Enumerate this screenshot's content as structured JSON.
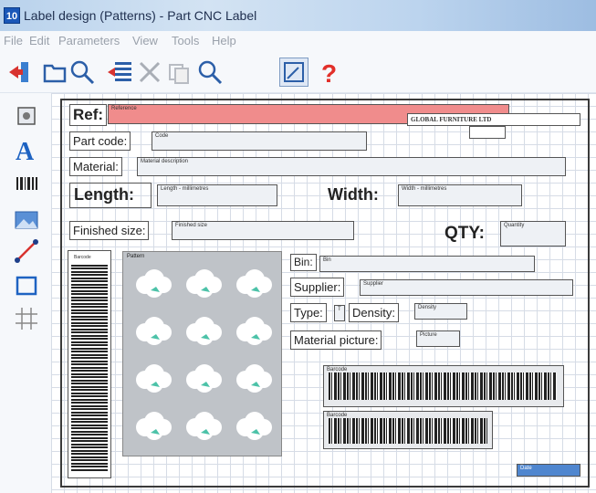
{
  "window": {
    "app_icon": "10",
    "title": "Label design (Patterns) - Part CNC Label"
  },
  "menu": [
    "File",
    "Edit",
    "Parameters",
    "View",
    "Tools",
    "Help"
  ],
  "toolbar_icons": [
    "exit-icon",
    "open-icon",
    "print-preview-icon",
    "import-icon",
    "cut-icon",
    "copy-icon",
    "zoom-icon",
    "select-icon",
    "help-icon"
  ],
  "left_tools": [
    "image-tool-icon",
    "text-tool-icon",
    "barcode-tool-icon",
    "picture-tool-icon",
    "line-tool-icon",
    "rectangle-tool-icon",
    "grid-tool-icon"
  ],
  "label": {
    "ref_label": "Ref:",
    "ref_value": "Reference",
    "company": "GLOBAL FURNITURE LTD",
    "part_code_label": "Part code:",
    "part_code_value": "Code",
    "material_label": "Material:",
    "material_value": "Material description",
    "length_label": "Length:",
    "length_value": "Length - millimetres",
    "width_label": "Width:",
    "width_value": "Width - millimetres",
    "finished_label": "Finished size:",
    "finished_value": "Finished size",
    "qty_label": "QTY:",
    "qty_value": "Quantity",
    "vbarcode_caption": "Barcode",
    "pattern_caption": "Pattern",
    "bin_label": "Bin:",
    "bin_value": "Bin",
    "supplier_label": "Supplier:",
    "supplier_value": "Supplier",
    "type_label": "Type:",
    "type_value": "T",
    "density_label": "Density:",
    "density_value": "Density",
    "material_picture_label": "Material picture:",
    "picture_value": "Picture",
    "barcode1_caption": "Barcode",
    "barcode2_caption": "Barcode",
    "date_value": "Date"
  },
  "colors": {
    "ref_highlight": "#f08c8c",
    "date_highlight": "#4f86cf",
    "help_red": "#e2302a"
  }
}
